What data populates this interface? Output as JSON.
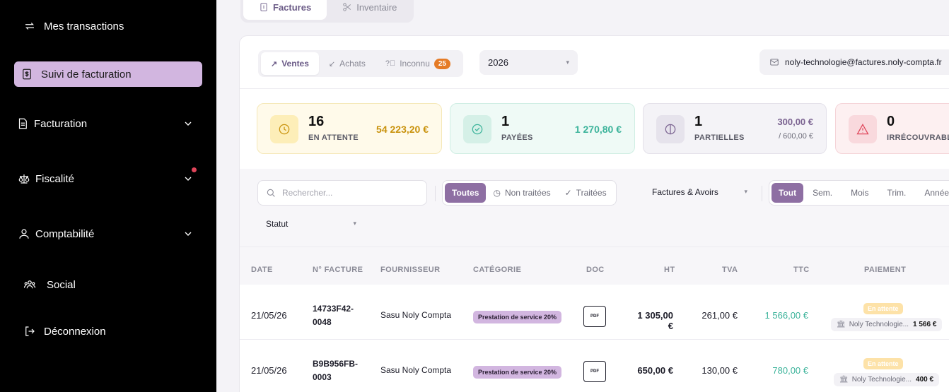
{
  "sidebar": {
    "items": [
      {
        "label": "Mes transactions",
        "icon": "transfer-icon"
      },
      {
        "label": "Suivi de facturation",
        "icon": "invoice-icon",
        "active": true
      },
      {
        "label": "Facturation",
        "icon": "document-icon"
      },
      {
        "label": "Fiscalité",
        "icon": "scale-icon"
      },
      {
        "label": "Comptabilité",
        "icon": "user-icon"
      },
      {
        "label": "Social",
        "icon": "users-icon"
      },
      {
        "label": "Déconnexion",
        "icon": "logout-icon"
      }
    ]
  },
  "top_tabs": [
    {
      "label": "Factures",
      "active": true
    },
    {
      "label": "Inventaire",
      "active": false
    }
  ],
  "segment": {
    "sales": "Ventes",
    "purchases": "Achats",
    "unknown": "Inconnu",
    "unknown_count": "25"
  },
  "year": "2026",
  "email": "noly-technologie@factures.noly-compta.fr",
  "stats": [
    {
      "count": "16",
      "label": "EN ATTENTE",
      "amount": "54 223,20 €"
    },
    {
      "count": "1",
      "label": "PAYÉES",
      "amount": "1 270,80 €"
    },
    {
      "count": "1",
      "label": "PARTIELLES",
      "amount": "300,00 €",
      "amount_total": "/ 600,00 €"
    },
    {
      "count": "0",
      "label": "IRRÉCOUVRABLE"
    }
  ],
  "filters": {
    "search_placeholder": "Rechercher...",
    "status_all": "Toutes",
    "status_untreated": "Non traitées",
    "status_treated": "Traitées",
    "doc_type": "Factures & Avoirs",
    "periods": [
      "Tout",
      "Sem.",
      "Mois",
      "Trim.",
      "Année"
    ],
    "status_select": "Statut"
  },
  "table": {
    "headers": [
      "DATE",
      "N° FACTURE",
      "FOURNISSEUR",
      "CATÉGORIE",
      "DOC",
      "HT",
      "TVA",
      "TTC",
      "PAIEMENT"
    ],
    "rows": [
      {
        "date": "21/05/26",
        "invoice_line1": "14733F42-",
        "invoice_line2": "0048",
        "supplier": "Sasu Noly Compta",
        "category": "Prestation de service 20%",
        "doc": "PDF",
        "ht": "1 305,00 €",
        "tva": "261,00 €",
        "ttc": "1 566,00 €",
        "payment_status": "En attente",
        "bank": "Noly Technologie...",
        "bank_amount": "1 566 €"
      },
      {
        "date": "21/05/26",
        "invoice_line1": "B9B956FB-",
        "invoice_line2": "0003",
        "supplier": "Sasu Noly Compta",
        "category": "Prestation de service 20%",
        "doc": "PDF",
        "ht": "650,00 €",
        "tva": "130,00 €",
        "ttc": "780,00 €",
        "payment_status": "En attente",
        "bank": "Noly Technologie...",
        "bank_amount": "400 €"
      }
    ]
  },
  "colors": {
    "sidebar_bg": "#000000",
    "active_nav": "#d2b6e0",
    "accent_purple": "#8e6fa3",
    "pending_gold": "#c9920c",
    "paid_teal": "#3bb39a",
    "partial_purple": "#7a6290",
    "alert_red": "#e0455a"
  }
}
